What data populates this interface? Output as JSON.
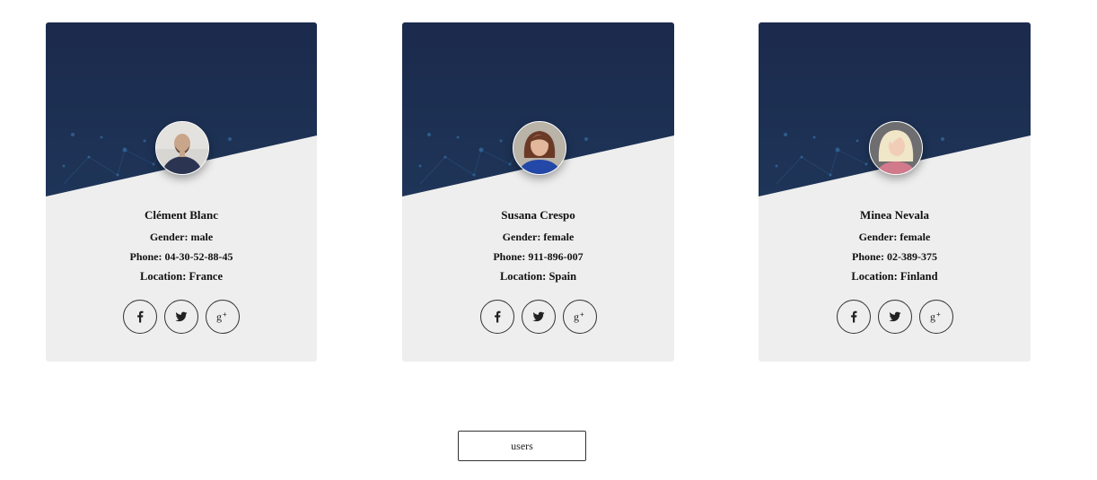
{
  "cards": [
    {
      "name": "Clément Blanc",
      "gender": "Gender: male",
      "phone": "Phone: 04-30-52-88-45",
      "location": "Location: France"
    },
    {
      "name": "Susana Crespo",
      "gender": "Gender: female",
      "phone": "Phone: 911-896-007",
      "location": "Location: Spain"
    },
    {
      "name": "Minea Nevala",
      "gender": "Gender: female",
      "phone": "Phone: 02-389-375",
      "location": "Location: Finland"
    }
  ],
  "social_icons": [
    "facebook-icon",
    "twitter-icon",
    "google-plus-icon"
  ],
  "users_button_label": "users",
  "colors": {
    "header_dark": "#1d2d50",
    "card_bg": "#eeeeee",
    "page_bg": "#ffffff",
    "text": "#111111"
  }
}
